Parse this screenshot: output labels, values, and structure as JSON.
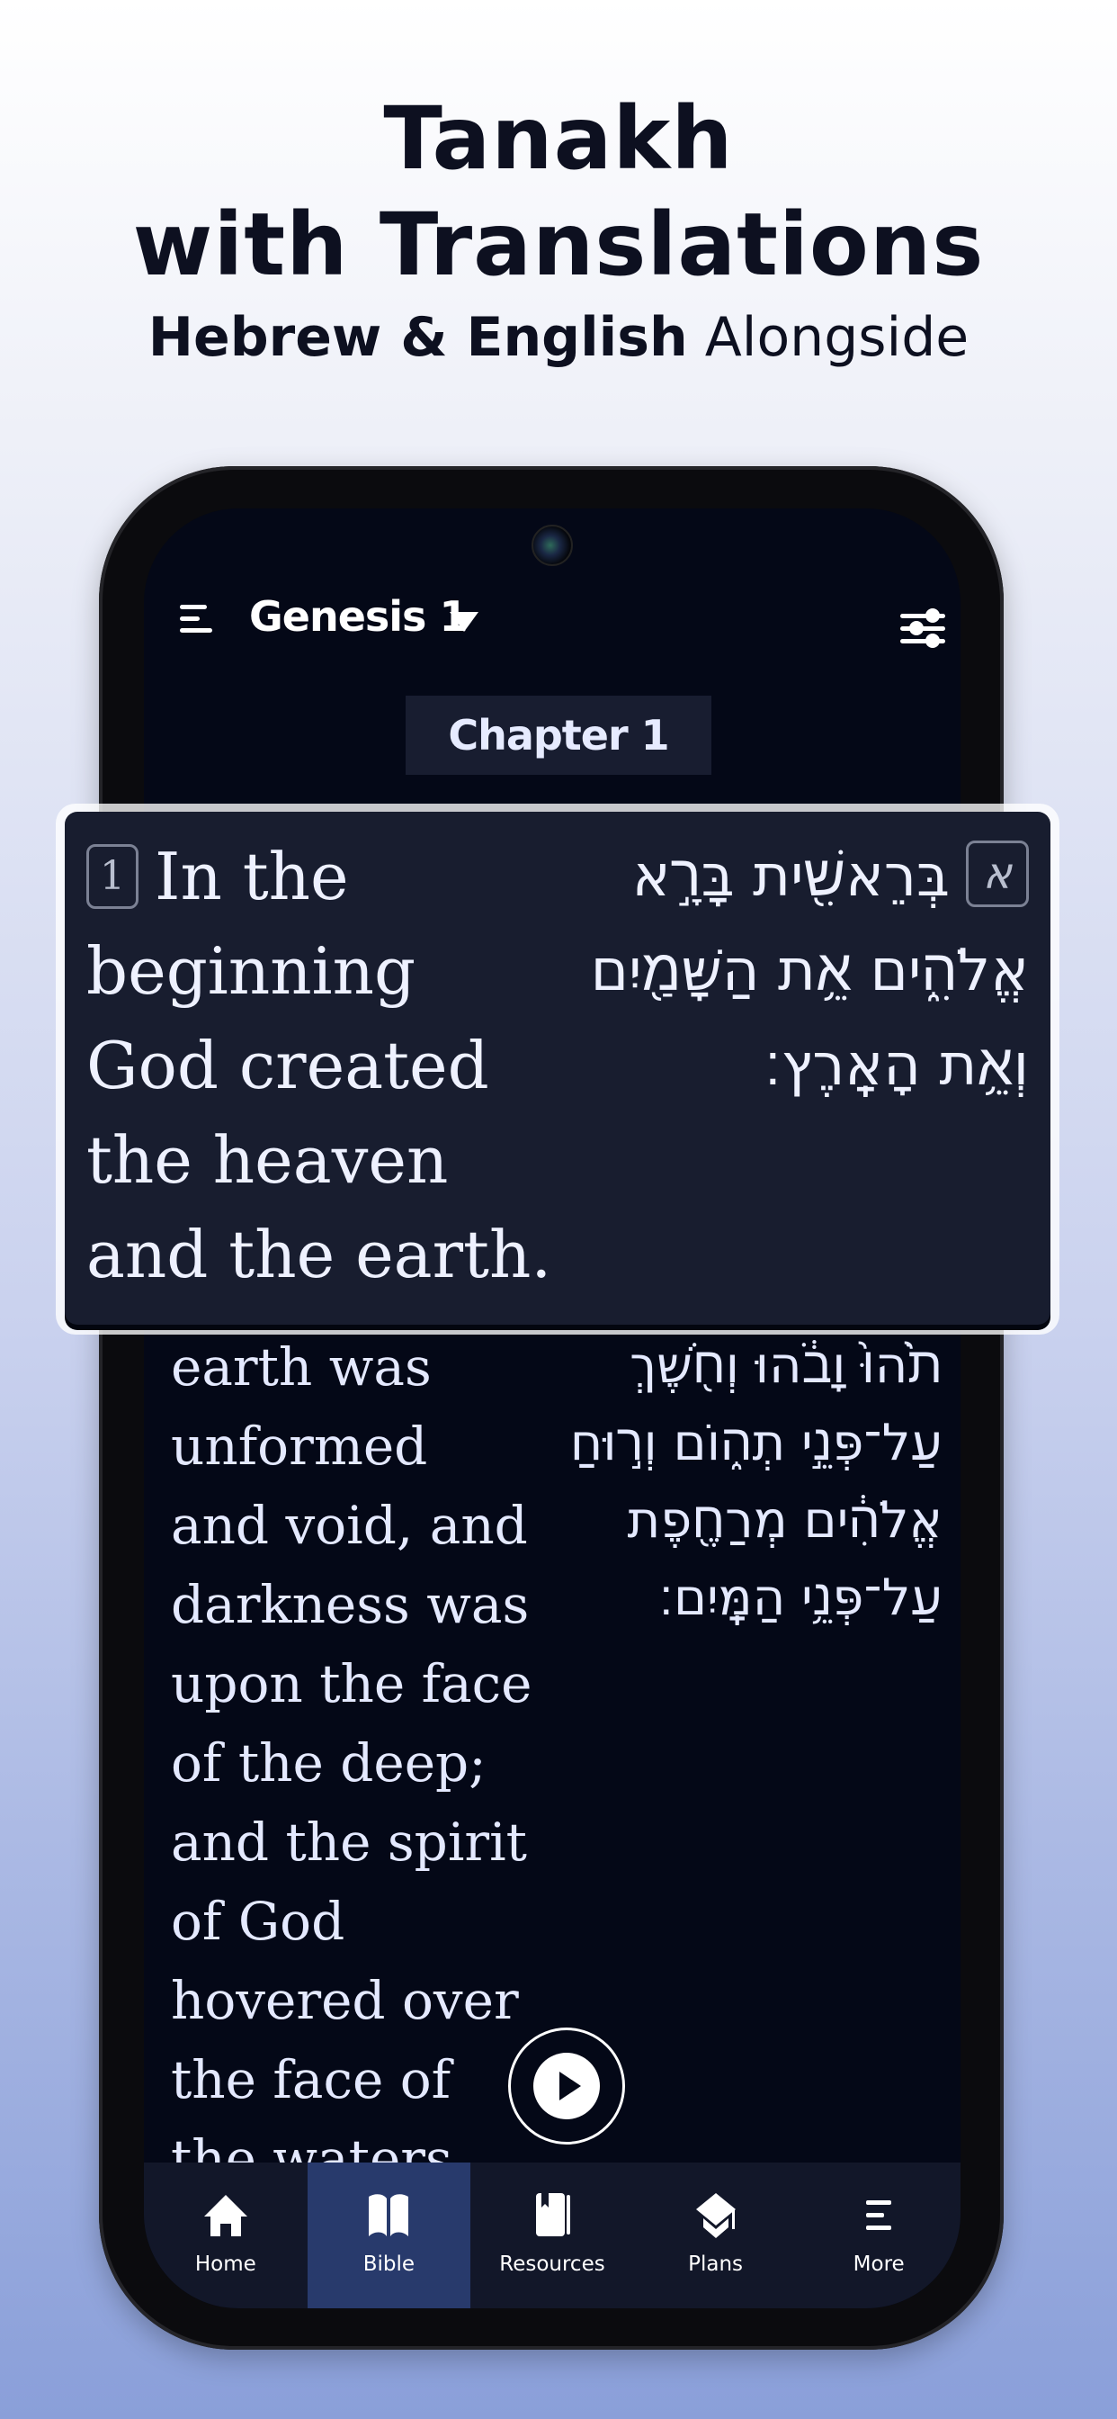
{
  "hero": {
    "title_line1": "Tanakh",
    "title_line2": "with Translations",
    "subtitle_bold": "Hebrew & English",
    "subtitle_light": "Alongside"
  },
  "reader": {
    "book_chapter": "Genesis 1",
    "chapter_label": "Chapter 1",
    "icons": {
      "menu": "hamburger-menu-icon",
      "dropdown": "caret-down-icon",
      "settings": "sliders-icon",
      "play": "play-icon"
    },
    "highlighted_verse": {
      "number": "1",
      "hebrew_number": "א",
      "english_lines": [
        "In the",
        "beginning",
        "God created",
        "the heaven",
        "and the earth."
      ],
      "hebrew_lines": [
        "בְּרֵאשִׁ֖ית בָּרָ֣א",
        "אֱלֹהִ֑ים אֵ֥ת הַשָּׁמַ֖יִם",
        "וְאֵ֥ת הָאָֽרֶץ׃"
      ]
    },
    "verse_2": {
      "english_lines": [
        "earth was",
        "unformed",
        "and void, and",
        "darkness was",
        "upon the face",
        "of the deep;",
        "and the spirit",
        "of God",
        "hovered over",
        "the face of",
        "the waters."
      ],
      "hebrew_lines": [
        "תֹ֙הוּ֙ וָבֹ֔הוּ וְחֹ֖שֶׁךְ",
        "עַל־פְּנֵ֣י תְה֑וֹם וְר֣וּחַ",
        "אֱלֹהִ֔ים מְרַחֶ֖פֶת",
        "עַל־פְּנֵ֥י הַמָּֽיִם׃"
      ]
    }
  },
  "tabbar": {
    "active": "Bible",
    "items": [
      {
        "label": "Home",
        "icon": "home-icon"
      },
      {
        "label": "Bible",
        "icon": "open-book-icon"
      },
      {
        "label": "Resources",
        "icon": "bookmark-book-icon"
      },
      {
        "label": "Plans",
        "icon": "graduation-cap-icon"
      },
      {
        "label": "More",
        "icon": "more-menu-icon"
      }
    ]
  },
  "colors": {
    "screen_bg": "#040817",
    "card_bg": "#181d2f",
    "tab_active": "#283a6c",
    "tabbar_bg": "#121729"
  }
}
